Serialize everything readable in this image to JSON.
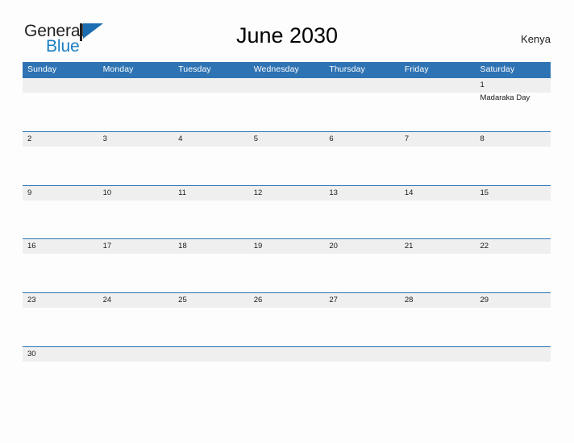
{
  "brand": {
    "name_part1": "General",
    "name_part2": "Blue",
    "flag_icon": "blue-triangle-flag-icon",
    "color_dark": "#231f20",
    "color_blue": "#1b7fc4"
  },
  "header": {
    "title": "June 2030",
    "region": "Kenya"
  },
  "colors": {
    "header_blue": "#2e73b3",
    "band_gray": "#efefef",
    "background": "#fdfdfd",
    "text": "#1a1a1a"
  },
  "calendar": {
    "day_headers": [
      "Sunday",
      "Monday",
      "Tuesday",
      "Wednesday",
      "Thursday",
      "Friday",
      "Saturday"
    ],
    "weeks": [
      {
        "days": [
          {
            "num": "",
            "event": ""
          },
          {
            "num": "",
            "event": ""
          },
          {
            "num": "",
            "event": ""
          },
          {
            "num": "",
            "event": ""
          },
          {
            "num": "",
            "event": ""
          },
          {
            "num": "",
            "event": ""
          },
          {
            "num": "1",
            "event": "Madaraka Day"
          }
        ]
      },
      {
        "days": [
          {
            "num": "2",
            "event": ""
          },
          {
            "num": "3",
            "event": ""
          },
          {
            "num": "4",
            "event": ""
          },
          {
            "num": "5",
            "event": ""
          },
          {
            "num": "6",
            "event": ""
          },
          {
            "num": "7",
            "event": ""
          },
          {
            "num": "8",
            "event": ""
          }
        ]
      },
      {
        "days": [
          {
            "num": "9",
            "event": ""
          },
          {
            "num": "10",
            "event": ""
          },
          {
            "num": "11",
            "event": ""
          },
          {
            "num": "12",
            "event": ""
          },
          {
            "num": "13",
            "event": ""
          },
          {
            "num": "14",
            "event": ""
          },
          {
            "num": "15",
            "event": ""
          }
        ]
      },
      {
        "days": [
          {
            "num": "16",
            "event": ""
          },
          {
            "num": "17",
            "event": ""
          },
          {
            "num": "18",
            "event": ""
          },
          {
            "num": "19",
            "event": ""
          },
          {
            "num": "20",
            "event": ""
          },
          {
            "num": "21",
            "event": ""
          },
          {
            "num": "22",
            "event": ""
          }
        ]
      },
      {
        "days": [
          {
            "num": "23",
            "event": ""
          },
          {
            "num": "24",
            "event": ""
          },
          {
            "num": "25",
            "event": ""
          },
          {
            "num": "26",
            "event": ""
          },
          {
            "num": "27",
            "event": ""
          },
          {
            "num": "28",
            "event": ""
          },
          {
            "num": "29",
            "event": ""
          }
        ]
      },
      {
        "days": [
          {
            "num": "30",
            "event": ""
          },
          {
            "num": "",
            "event": ""
          },
          {
            "num": "",
            "event": ""
          },
          {
            "num": "",
            "event": ""
          },
          {
            "num": "",
            "event": ""
          },
          {
            "num": "",
            "event": ""
          },
          {
            "num": "",
            "event": ""
          }
        ]
      }
    ]
  }
}
